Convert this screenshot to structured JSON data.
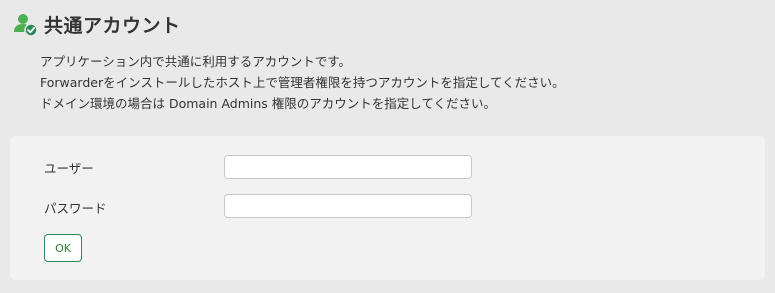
{
  "header": {
    "title": "共通アカウント",
    "icon": "user-check-icon"
  },
  "description": {
    "line1": "アプリケーション内で共通に利用するアカウントです。",
    "line2": "Forwarderをインストールしたホスト上で管理者権限を持つアカウントを指定してください。",
    "line3": "ドメイン環境の場合は Domain Admins 権限のアカウントを指定してください。"
  },
  "form": {
    "username_label": "ユーザー",
    "username_value": "",
    "password_label": "パスワード",
    "password_value": "",
    "ok_label": "OK"
  },
  "colors": {
    "accent": "#2e8b57",
    "icon_green": "#4caf50",
    "panel_bg": "#f2f2f2",
    "page_bg": "#e9e9e9"
  }
}
